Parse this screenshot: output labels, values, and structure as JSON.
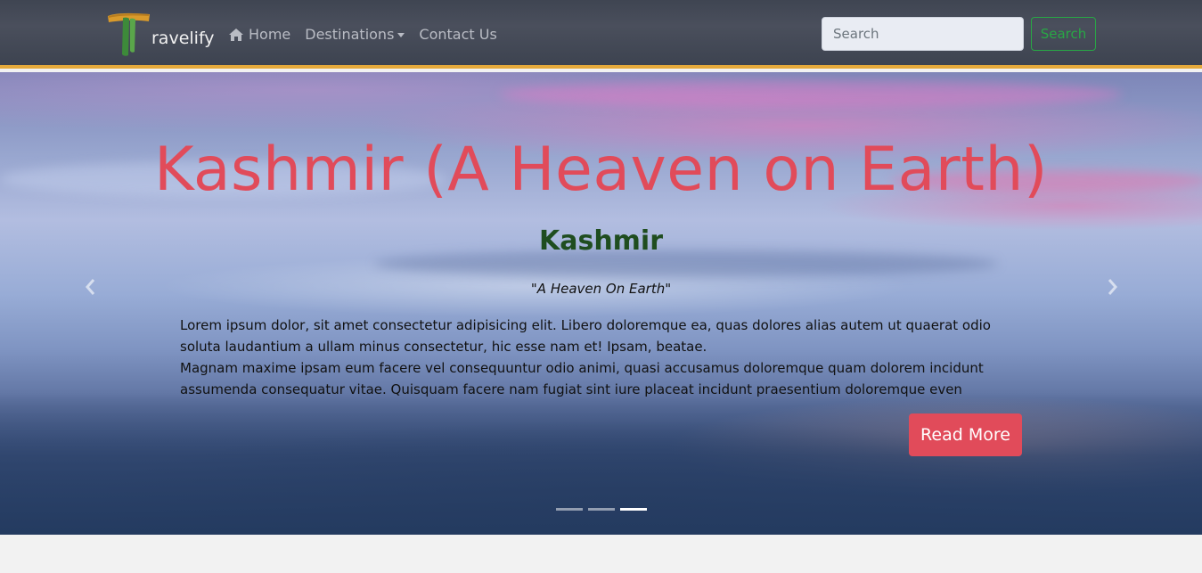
{
  "navbar": {
    "brand_text": "ravelify",
    "links": [
      {
        "label": "Home",
        "icon": "home-icon"
      },
      {
        "label": "Destinations",
        "icon": "caret-down-icon"
      },
      {
        "label": "Contact Us"
      }
    ],
    "search": {
      "placeholder": "Search",
      "button_label": "Search"
    },
    "colors": {
      "accent_border": "#e5a93b",
      "search_green": "#28a745"
    }
  },
  "hero": {
    "title": "Kashmir (A Heaven on Earth)",
    "subtitle": "Kashmir",
    "quote": "\"A Heaven On Earth\"",
    "paragraph_1": "Lorem ipsum dolor, sit amet consectetur adipisicing elit. Libero doloremque ea, quas dolores alias autem ut quaerat odio soluta laudantium a ullam minus consectetur, hic esse nam et! Ipsam, beatae.",
    "paragraph_2": "Magnam maxime ipsam eum facere vel consequuntur odio animi, quasi accusamus doloremque quam dolorem incidunt assumenda consequatur vitae. Quisquam facere nam fugiat sint iure placeat incidunt praesentium doloremque even",
    "button_label": "Read More",
    "colors": {
      "title": "#e14b5a",
      "subtitle": "#1f4d1f",
      "button": "#e14b5a"
    },
    "carousel": {
      "slide_count": 3,
      "active_index": 2
    }
  }
}
